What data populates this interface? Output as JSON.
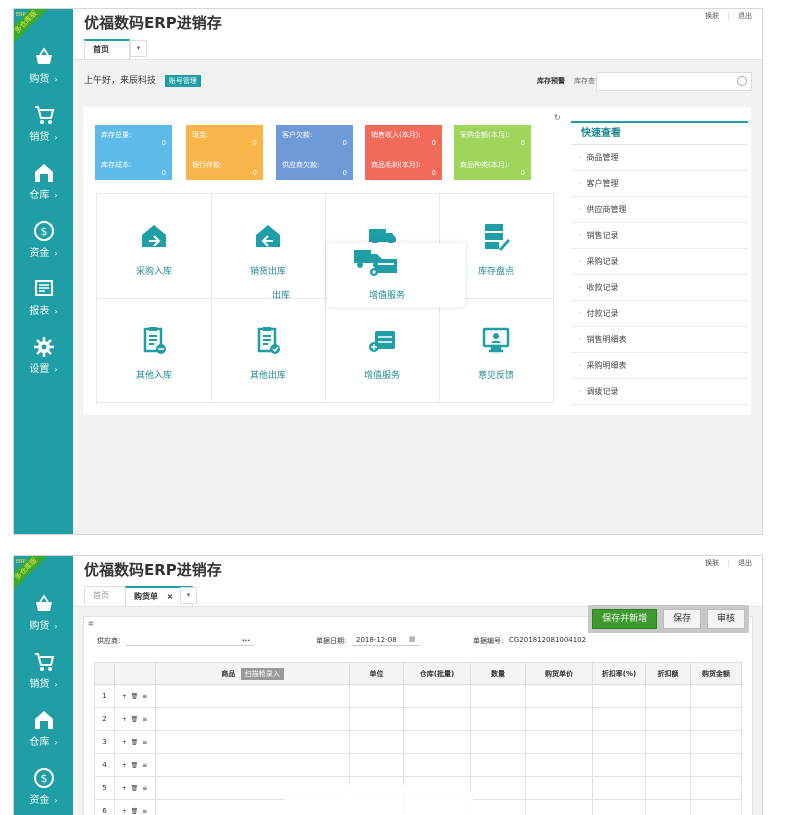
{
  "app": {
    "title": "优福数码ERP进销存",
    "ribbon": "多仓库版",
    "ribbon_small": "ERP",
    "top_links": [
      "换肤",
      "退出"
    ]
  },
  "sidebar": {
    "items": [
      {
        "label": "购货",
        "icon": "basket-icon"
      },
      {
        "label": "销货",
        "icon": "cart-icon"
      },
      {
        "label": "仓库",
        "icon": "warehouse-icon"
      },
      {
        "label": "资金",
        "icon": "dollar-icon"
      },
      {
        "label": "报表",
        "icon": "report-icon"
      },
      {
        "label": "设置",
        "icon": "gear-icon"
      }
    ],
    "arrow": "›"
  },
  "home": {
    "tabs": [
      "首页"
    ],
    "greeting": "上午好，来辰科技",
    "account_button": "账号管理",
    "stock_alert": "库存预警",
    "stock_query": "库存查询",
    "stats": [
      {
        "color": "#5dbbea",
        "rows": [
          {
            "label": "库存总量:",
            "value": "0"
          },
          {
            "label": "库存成本:",
            "value": "0"
          }
        ]
      },
      {
        "color": "#f8b54a",
        "rows": [
          {
            "label": "现金:",
            "value": "0"
          },
          {
            "label": "银行存款:",
            "value": "0"
          }
        ]
      },
      {
        "color": "#6f9ad8",
        "rows": [
          {
            "label": "客户欠款:",
            "value": "0"
          },
          {
            "label": "供应商欠款:",
            "value": "0"
          }
        ]
      },
      {
        "color": "#f26a5a",
        "rows": [
          {
            "label": "销售收入(本月):",
            "value": "0"
          },
          {
            "label": "商品毛利(本月):",
            "value": "0"
          }
        ]
      },
      {
        "color": "#9ed55a",
        "rows": [
          {
            "label": "采购金额(本月):",
            "value": "0"
          },
          {
            "label": "商品种类(本月):",
            "value": "0"
          }
        ]
      }
    ],
    "shortcuts": [
      {
        "label": "采购入库",
        "icon": "purchase-in-icon"
      },
      {
        "label": "销货出库",
        "icon": "sales-out-icon"
      },
      {
        "label": "",
        "icon": "truck-icon"
      },
      {
        "label": "库存盘点",
        "icon": "inventory-check-icon"
      },
      {
        "label": "其他入库",
        "icon": "other-in-icon"
      },
      {
        "label": "其他出库",
        "icon": "other-out-icon"
      },
      {
        "label": "增值服务",
        "icon": "value-service-icon"
      },
      {
        "label": "意见反馈",
        "icon": "feedback-icon"
      }
    ],
    "overlay": {
      "label": "增值服务",
      "fragment_left": "出库"
    },
    "quick_view": {
      "title": "快速查看",
      "items": [
        "商品管理",
        "客户管理",
        "供应商管理",
        "销售记录",
        "采购记录",
        "收款记录",
        "付款记录",
        "销售明细表",
        "采购明细表",
        "调拨记录"
      ]
    }
  },
  "purchase": {
    "tabs": [
      "首页",
      "购货单"
    ],
    "tab_close": "×",
    "buttons": {
      "save_new": "保存并新增",
      "save": "保存",
      "audit": "审核"
    },
    "supplier_label": "供应商:",
    "supplier_more": "...",
    "date_label": "单据日期:",
    "date_value": "2018-12-08",
    "number_label": "单据编号:",
    "number_value": "CG201812081004102",
    "columns": [
      "",
      "",
      "商品",
      "单位",
      "仓库(批量)",
      "数量",
      "购货单价",
      "折扣率(%)",
      "折扣额",
      "购货金额"
    ],
    "scan_button": "扫描枪录入",
    "rows": [
      "1",
      "2",
      "3",
      "4",
      "5",
      "6"
    ],
    "row_ops": "+ 🗑 ≡"
  }
}
